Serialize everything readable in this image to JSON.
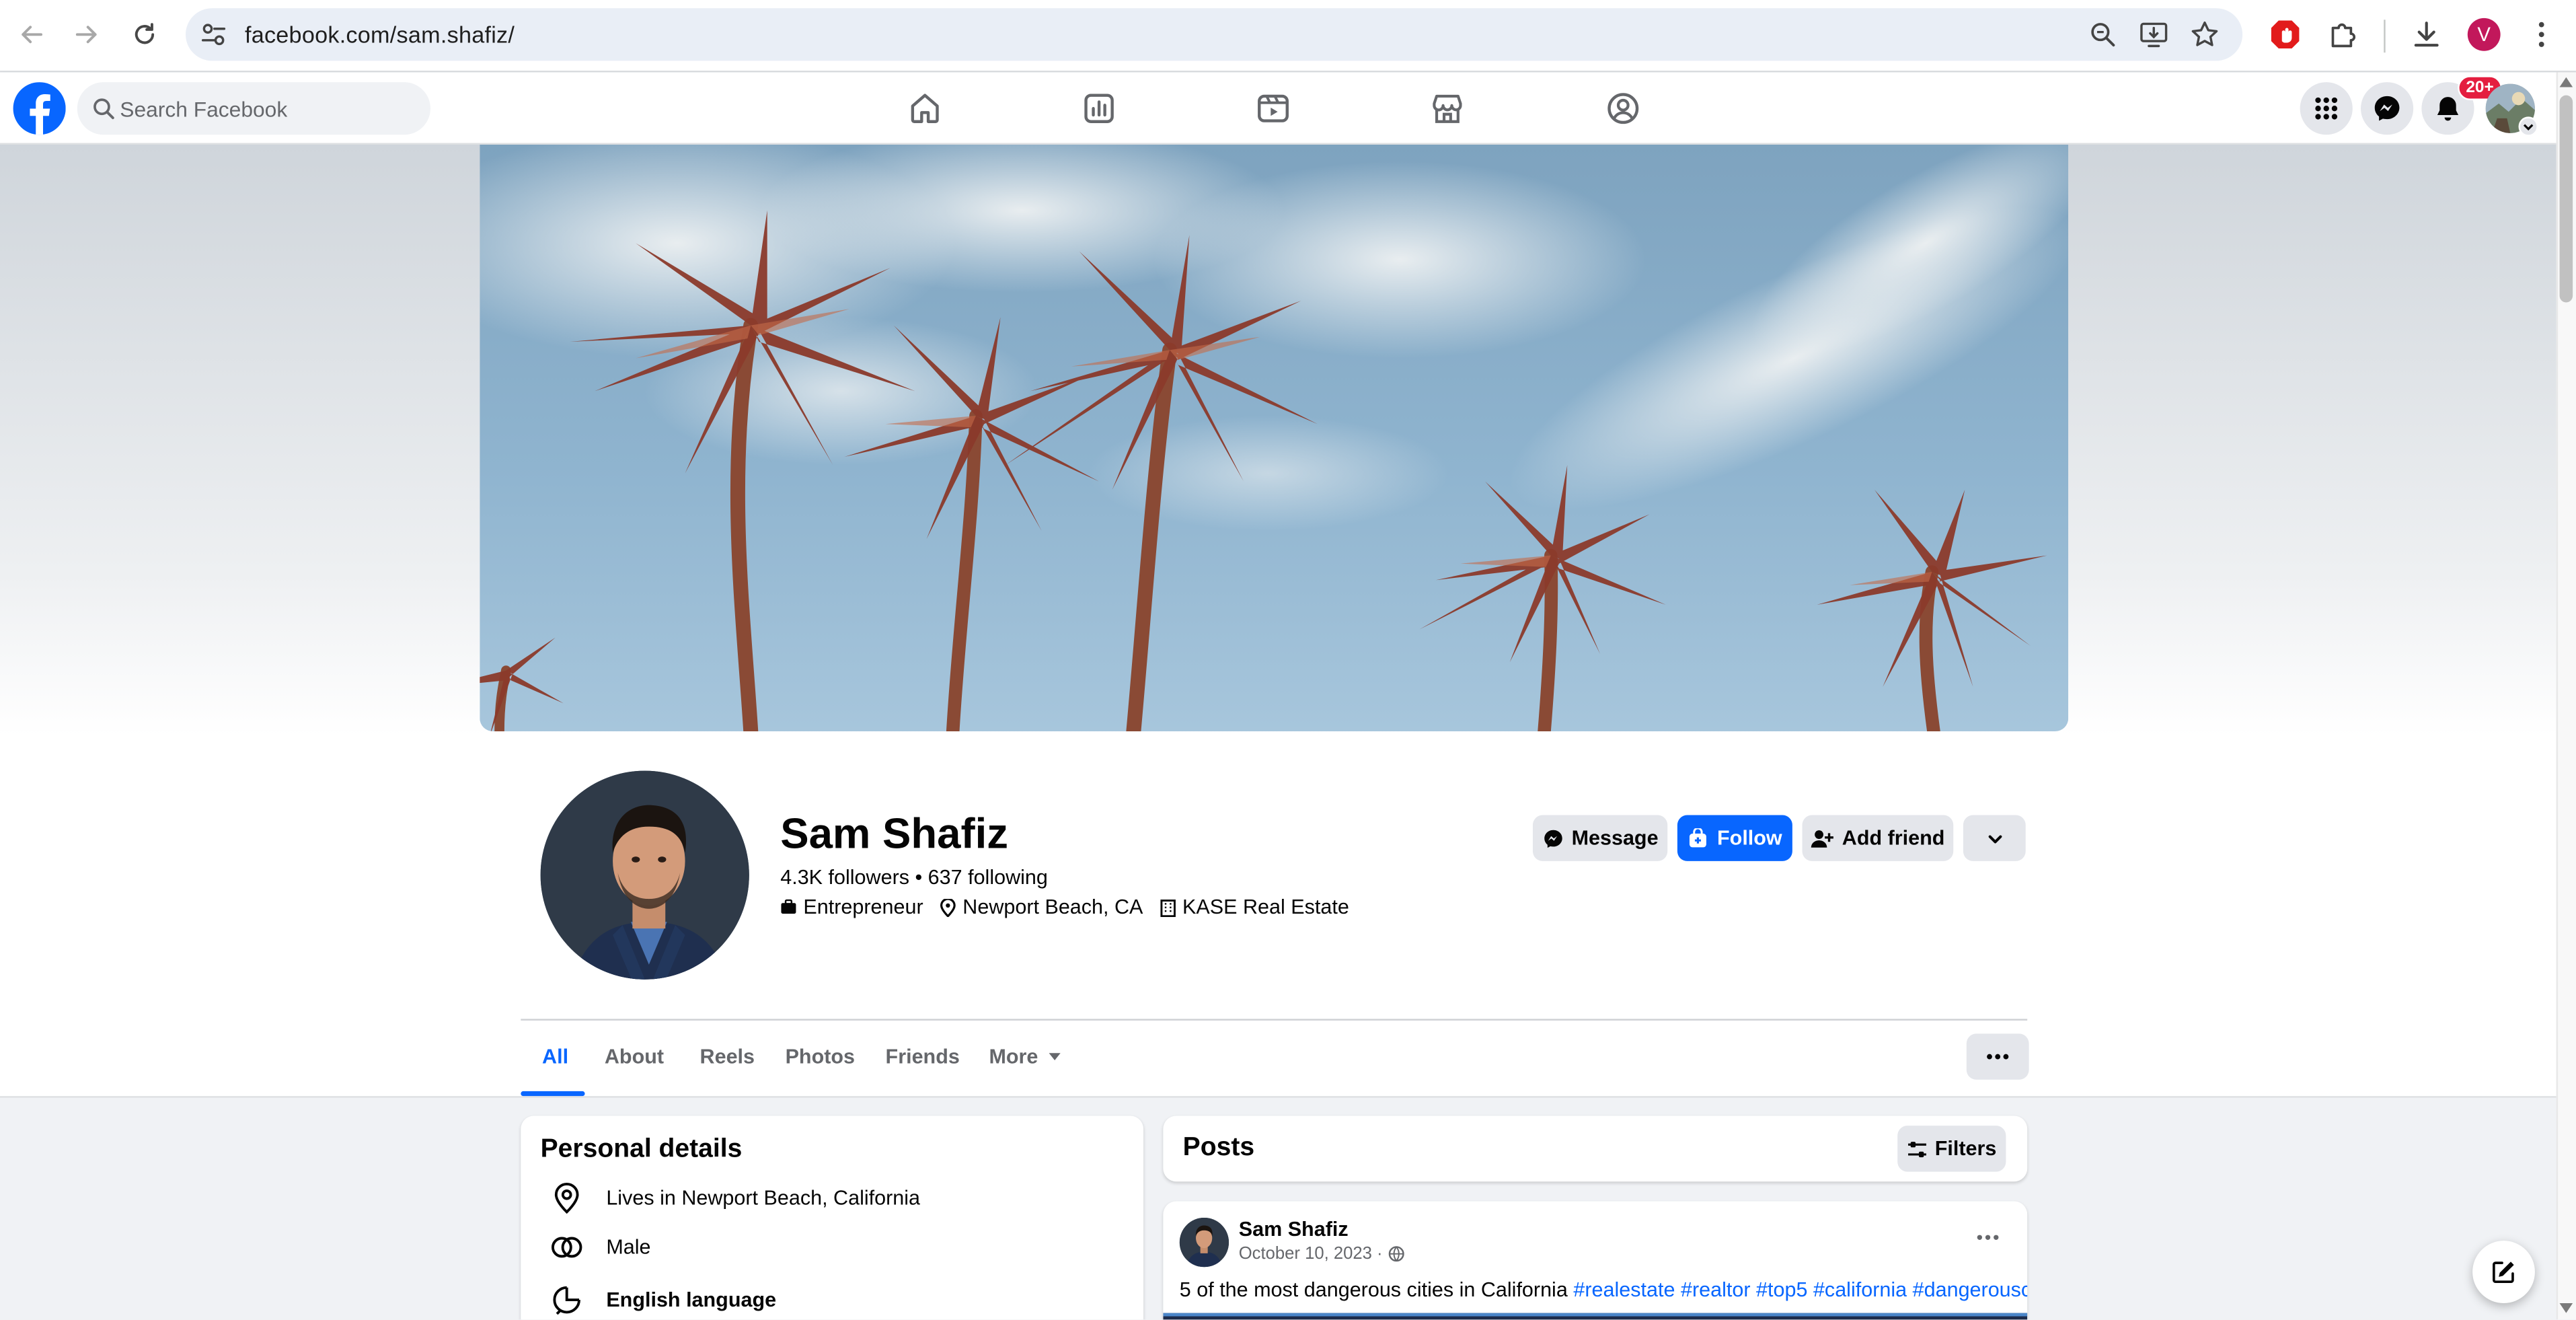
{
  "browser": {
    "url": "facebook.com/sam.shafiz/",
    "profile_initial": "V",
    "icons": [
      "back-icon",
      "forward-icon",
      "reload-icon",
      "site-settings-icon",
      "zoom-icon",
      "install-app-icon",
      "bookmark-star-icon",
      "adblock-extension-icon",
      "extensions-puzzle-icon",
      "download-icon",
      "kebab-menu-icon"
    ]
  },
  "fbnav": {
    "search_placeholder": "Search Facebook",
    "tabs": [
      "home-icon",
      "dashboard-icon",
      "video-icon",
      "marketplace-icon",
      "gaming-icon"
    ],
    "notification_badge": "20+",
    "colors": {
      "brand": "#0866ff",
      "badge": "#e41e3f"
    }
  },
  "profile": {
    "name": "Sam Shafiz",
    "followers_line": "4.3K followers • 637 following",
    "intro": {
      "work_title": "Entrepreneur",
      "location": "Newport Beach, CA",
      "company": "KASE Real Estate"
    },
    "buttons": {
      "message": "Message",
      "follow": "Follow",
      "add_friend": "Add friend"
    }
  },
  "profile_tabs": {
    "items": [
      "All",
      "About",
      "Reels",
      "Photos",
      "Friends",
      "More"
    ],
    "active": "All"
  },
  "personal_details": {
    "title": "Personal details",
    "rows": [
      {
        "icon": "location-pin-icon",
        "text": "Lives in Newport Beach, California"
      },
      {
        "icon": "gender-icon",
        "text": "Male"
      },
      {
        "icon": "language-icon",
        "text": "English language"
      }
    ]
  },
  "posts": {
    "title": "Posts",
    "filters_label": "Filters",
    "first_post": {
      "author": "Sam Shafiz",
      "date": "October 10, 2023 ·",
      "audience_icon": "globe-icon",
      "text": "5 of the most dangerous cities in California",
      "hashtags": [
        "#realestate",
        "#realtor",
        "#top5",
        "#california",
        "#dangerouscity"
      ]
    }
  }
}
